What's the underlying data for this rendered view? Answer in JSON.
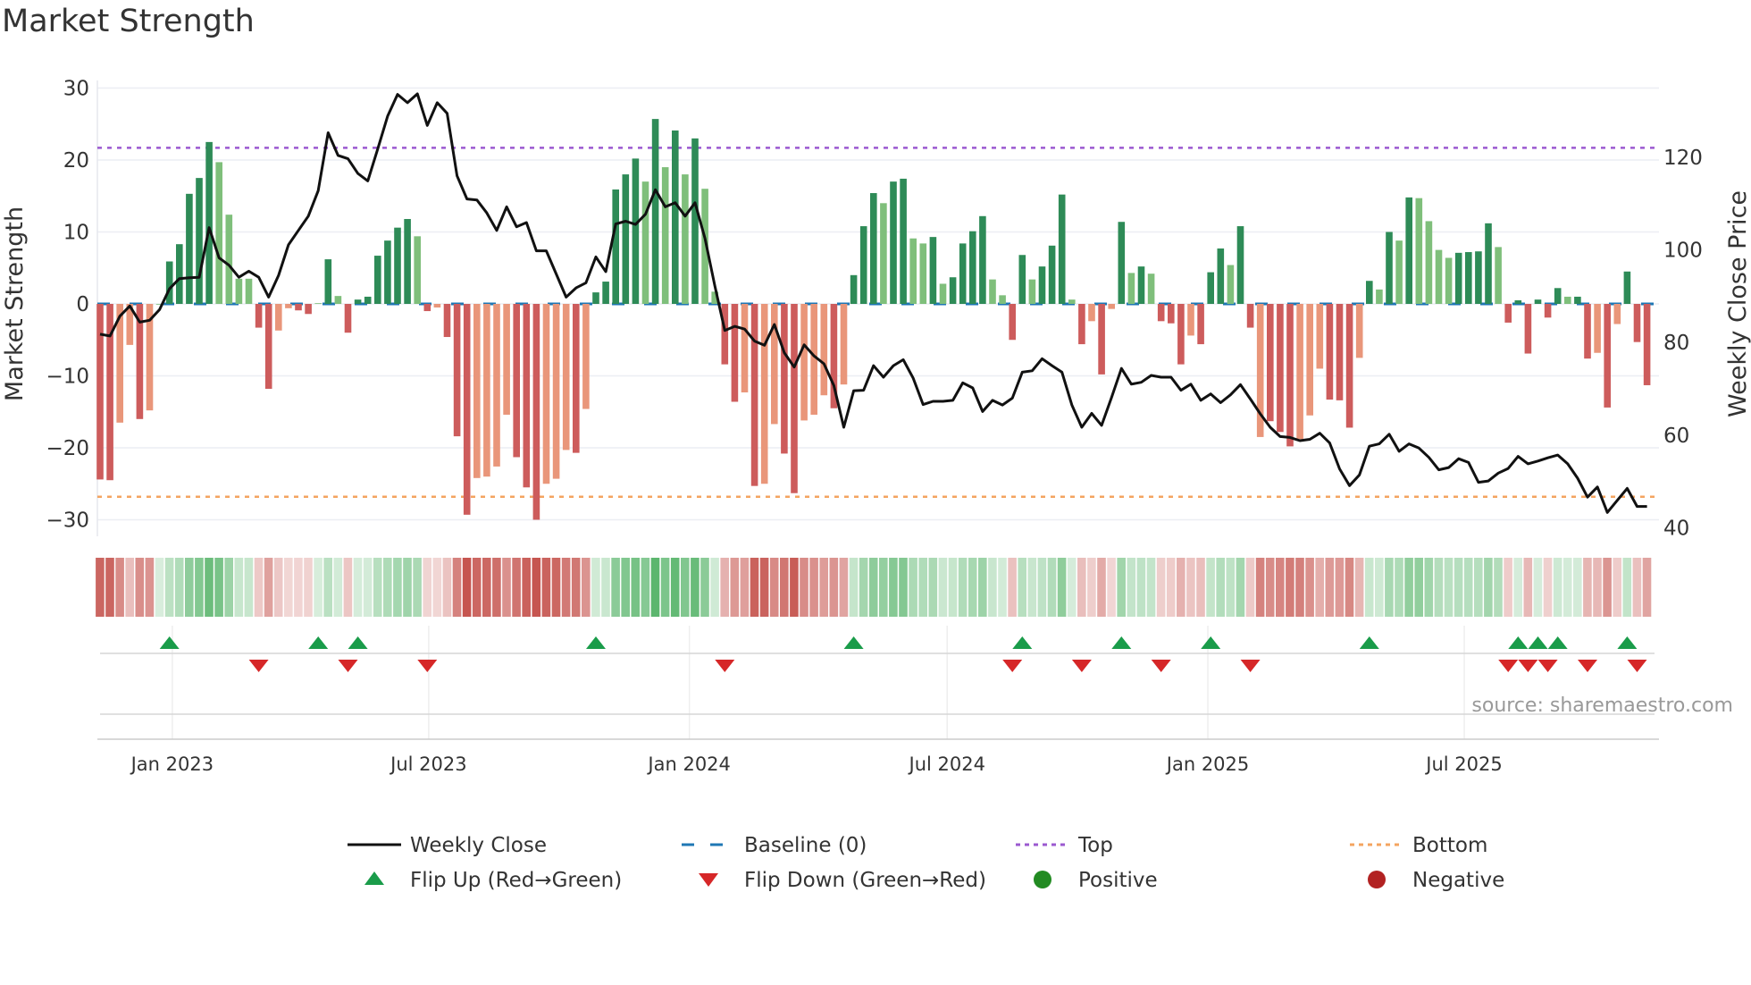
{
  "title": "Market Strength",
  "source": "source: sharemaestro.com",
  "colors": {
    "pos_dark": "#2e8b57",
    "pos_light": "#7fbf7b",
    "neg_dark": "#cd5c5c",
    "neg_light": "#e9967a",
    "price": "#111111",
    "baseline": "#1f77b4",
    "top": "#9b59d0",
    "bottom": "#f4a460",
    "flip_up": "#1a9c4a",
    "flip_down": "#d62728",
    "positive": "#228b22",
    "negative": "#b22222"
  },
  "chart_data": {
    "type": "bar",
    "title": "Market Strength",
    "ylabel": "Market Strength",
    "y2label": "Weekly Close Price",
    "ylim": [
      -30,
      30
    ],
    "y2lim": [
      40,
      132
    ],
    "yticks": [
      "30",
      "20",
      "10",
      "0",
      "−10",
      "−20",
      "−30"
    ],
    "ytick_values": [
      30,
      20,
      10,
      0,
      -10,
      -20,
      -30
    ],
    "y2ticks": [
      "120",
      "100",
      "80",
      "60",
      "40"
    ],
    "y2tick_values": [
      120,
      100,
      80,
      60,
      40
    ],
    "xticks": [
      {
        "label": "Jan 2023",
        "date": "2023-01-01"
      },
      {
        "label": "Jul 2023",
        "date": "2023-07-01"
      },
      {
        "label": "Jan 2024",
        "date": "2024-01-01"
      },
      {
        "label": "Jul 2024",
        "date": "2024-07-01"
      },
      {
        "label": "Jan 2025",
        "date": "2025-01-01"
      },
      {
        "label": "Jul 2025",
        "date": "2025-07-01"
      }
    ],
    "start_week": "2022-11-11",
    "interval_days": 7,
    "top_level": 21.7,
    "bottom_level": -26.8,
    "strength": [
      -24.4,
      -24.5,
      -16.5,
      -5.7,
      -16,
      -14.8,
      0,
      5.9,
      8.3,
      15.3,
      17.5,
      22.5,
      19.7,
      12.4,
      3.5,
      3.5,
      -3.3,
      -11.8,
      -3.7,
      -0.6,
      -0.9,
      -1.4,
      0.1,
      6.2,
      1.1,
      -4,
      0.6,
      1,
      6.7,
      8.8,
      10.6,
      11.8,
      9.4,
      -1,
      -0.5,
      -4.6,
      -18.4,
      -29.3,
      -24.2,
      -24,
      -22.6,
      -15.4,
      -21.3,
      -25.5,
      -30,
      -25,
      -24.3,
      -20.3,
      -20.7,
      -14.6,
      1.6,
      3.1,
      15.9,
      18,
      20.2,
      17,
      25.7,
      19,
      24.1,
      18,
      23,
      16,
      1.7,
      -8.4,
      -13.6,
      -12.3,
      -25.3,
      -25,
      -16.7,
      -20.8,
      -26.3,
      -16.2,
      -15.4,
      -12.7,
      -14.5,
      -11.2,
      4,
      10.8,
      15.4,
      14,
      17,
      17.4,
      9.1,
      8.4,
      9.3,
      2.8,
      3.7,
      8.4,
      10.1,
      12.2,
      3.4,
      1.2,
      -5,
      6.8,
      3.4,
      5.2,
      8.1,
      15.2,
      0.6,
      -5.6,
      -2.4,
      -9.8,
      -0.7,
      11.4,
      4.3,
      5.2,
      4.2,
      -2.4,
      -2.7,
      -8.4,
      -4.4,
      -5.6,
      4.4,
      7.7,
      5.4,
      10.8,
      -3.3,
      -18.5,
      -16.3,
      -17.8,
      -19.8,
      -18.8,
      -15.5,
      -9,
      -13.3,
      -13.4,
      -17.2,
      -7.5,
      3.2,
      2,
      10,
      8.8,
      14.8,
      14.7,
      11.5,
      7.5,
      6.4,
      7.1,
      7.2,
      7.3,
      11.2,
      7.9,
      -2.6,
      0.5,
      -6.9,
      0.6,
      -1.9,
      2.2,
      1,
      1,
      -7.6,
      -6.8,
      -14.4,
      -2.8,
      4.5,
      -5.3,
      -11.3
    ],
    "rising": "DDLLDLLDDDDDLLLLDDLLDDLDLDDDDDDDLDLDDDLLLLDDDLLLDLDDDDDLDLDLDLLDDLDLLDDLLLDLDDDLDDLLDLDDDDLLDDLDDDLDLDLDLDLDDDLDDDLDDLDDDLLLDDDLDLDLDLLLLDDDDLDDDDDDLDDLDLDDD",
    "weekly_close": [
      81.8,
      81.4,
      85.7,
      87.9,
      84.4,
      84.8,
      87.1,
      91.6,
      93.8,
      94,
      94.1,
      104.8,
      98.3,
      96.7,
      94.1,
      95.4,
      94.1,
      89.8,
      94.5,
      101.1,
      104.2,
      107.3,
      112.8,
      125.3,
      120.4,
      119.7,
      116.5,
      114.9,
      121.8,
      128.9,
      133.6,
      131.8,
      133.7,
      126.9,
      131.8,
      129.5,
      116,
      111,
      110.8,
      108,
      104.2,
      109.3,
      105,
      105.9,
      99.8,
      99.8,
      94.8,
      89.8,
      91.8,
      92.9,
      98.5,
      95.3,
      105.6,
      106.2,
      105.5,
      107.7,
      113,
      109.3,
      110.2,
      107.3,
      110.2,
      102.5,
      92.2,
      82.6,
      83.5,
      82.9,
      80.3,
      79.4,
      83.9,
      77.8,
      74.7,
      79.5,
      77.1,
      75.4,
      70.7,
      61.7,
      69.6,
      69.7,
      75,
      72.5,
      75,
      76.3,
      72.3,
      66.6,
      67.3,
      67.3,
      67.5,
      71.3,
      70.2,
      65.1,
      67.5,
      66.5,
      68,
      73.6,
      73.9,
      76.5,
      75,
      73.6,
      66.5,
      61.7,
      64.7,
      62.1,
      68.1,
      74.4,
      71,
      71.4,
      72.9,
      72.5,
      72.5,
      69.7,
      71,
      67.5,
      68.9,
      67,
      68.7,
      70.9,
      67.8,
      64.6,
      61.7,
      59.7,
      59.5,
      58.8,
      59.1,
      60.4,
      58.3,
      52.7,
      49.1,
      51.4,
      57.6,
      58.1,
      60.2,
      56.5,
      58.1,
      57.2,
      55.2,
      52.5,
      53,
      54.9,
      54.1,
      49.8,
      50.1,
      51.8,
      52.8,
      55.4,
      53.8,
      54.4,
      55.1,
      55.7,
      53.8,
      50.7,
      46.6,
      48.8,
      43.3,
      45.9,
      48.5,
      44.6,
      44.6
    ],
    "flip_up_weeks": [
      7,
      22,
      26,
      50,
      76,
      93,
      103,
      112,
      128,
      143,
      145,
      147,
      154
    ],
    "flip_down_weeks": [
      16,
      25,
      33,
      63,
      92,
      99,
      107,
      116,
      142,
      144,
      146,
      150,
      155
    ],
    "legend_position": "bottom",
    "legend": [
      {
        "key": "close",
        "label": "Weekly Close"
      },
      {
        "key": "baseline",
        "label": "Baseline (0)"
      },
      {
        "key": "top",
        "label": "Top"
      },
      {
        "key": "bottom",
        "label": "Bottom"
      },
      {
        "key": "flip_up",
        "label": "Flip Up (Red→Green)"
      },
      {
        "key": "flip_down",
        "label": "Flip Down (Green→Red)"
      },
      {
        "key": "positive",
        "label": "Positive"
      },
      {
        "key": "negative",
        "label": "Negative"
      }
    ]
  }
}
